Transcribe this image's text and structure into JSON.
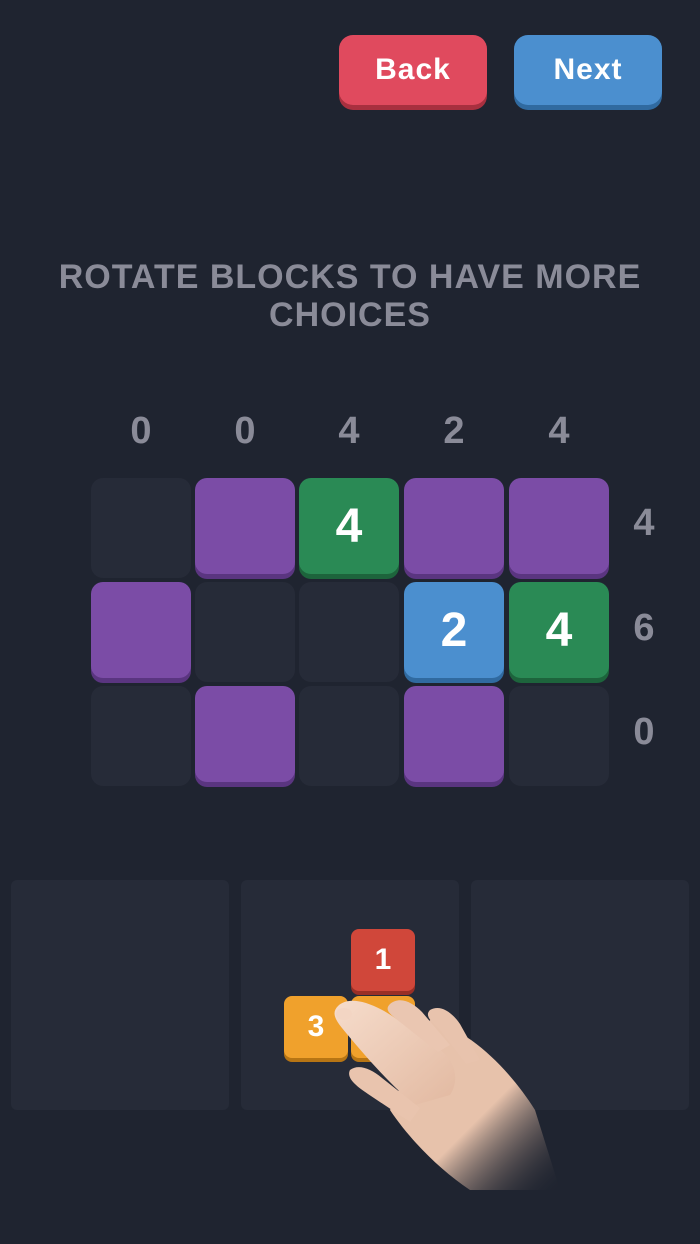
{
  "nav": {
    "back_label": "Back",
    "next_label": "Next"
  },
  "instruction": "ROTATE BLOCKS TO HAVE MORE CHOICES",
  "board": {
    "column_sums": [
      "0",
      "0",
      "4",
      "2",
      "4"
    ],
    "row_sums": [
      "4",
      "6",
      "0"
    ],
    "rows": [
      [
        {
          "color": "empty",
          "value": ""
        },
        {
          "color": "purple",
          "value": ""
        },
        {
          "color": "green",
          "value": "4"
        },
        {
          "color": "purple",
          "value": ""
        },
        {
          "color": "purple",
          "value": ""
        }
      ],
      [
        {
          "color": "purple",
          "value": ""
        },
        {
          "color": "empty",
          "value": ""
        },
        {
          "color": "empty",
          "value": ""
        },
        {
          "color": "blue",
          "value": "2"
        },
        {
          "color": "green",
          "value": "4"
        }
      ],
      [
        {
          "color": "empty",
          "value": ""
        },
        {
          "color": "purple",
          "value": ""
        },
        {
          "color": "empty",
          "value": ""
        },
        {
          "color": "purple",
          "value": ""
        },
        {
          "color": "empty",
          "value": ""
        }
      ]
    ]
  },
  "piece": {
    "blocks": [
      {
        "color": "red",
        "value": "1"
      },
      {
        "color": "orange",
        "value": "3"
      },
      {
        "color": "orange",
        "value": ""
      }
    ]
  },
  "colors": {
    "background": "#1f2430",
    "empty": "#262b38",
    "purple": "#7b4ca6",
    "green": "#2a8a55",
    "blue": "#4b8fcf",
    "red": "#d0473a",
    "orange": "#f0a12c",
    "back_button": "#e04a5e",
    "next_button": "#4b8fcf"
  }
}
